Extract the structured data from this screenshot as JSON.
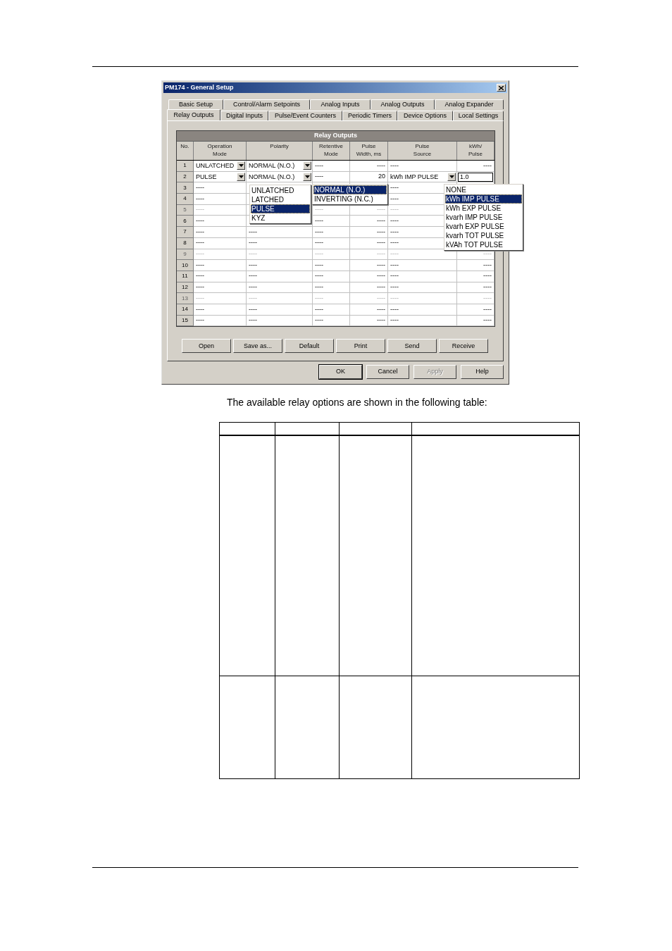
{
  "dialog": {
    "title": "PM174 - General Setup",
    "tab_rows": [
      [
        {
          "label": "Basic Setup",
          "selected": false
        },
        {
          "label": "Control/Alarm Setpoints",
          "selected": false
        },
        {
          "label": "Analog Inputs",
          "selected": false
        },
        {
          "label": "Analog Outputs",
          "selected": false
        },
        {
          "label": "Analog Expander",
          "selected": false
        }
      ],
      [
        {
          "label": "Relay Outputs",
          "selected": true
        },
        {
          "label": "Digital Inputs",
          "selected": false
        },
        {
          "label": "Pulse/Event Counters",
          "selected": false
        },
        {
          "label": "Periodic Timers",
          "selected": false
        },
        {
          "label": "Device Options",
          "selected": false
        },
        {
          "label": "Local Settings",
          "selected": false
        }
      ]
    ],
    "grid": {
      "title": "Relay Outputs",
      "columns": [
        "No.",
        "Operation\nMode",
        "Polarity",
        "Retentive\nMode",
        "Pulse\nWidth, ms",
        "Pulse\nSource",
        "kWh/\nPulse"
      ],
      "rows": [
        {
          "no": "1",
          "dimmed": false,
          "cells": [
            {
              "kind": "combo",
              "text": "UNLATCHED"
            },
            {
              "kind": "combo",
              "text": "NORMAL (N.O.)"
            },
            {
              "kind": "text",
              "text": "----"
            },
            {
              "kind": "text",
              "text": "----"
            },
            {
              "kind": "text",
              "text": "----"
            },
            {
              "kind": "text",
              "text": "----"
            }
          ]
        },
        {
          "no": "2",
          "dimmed": false,
          "cells": [
            {
              "kind": "combo",
              "text": "PULSE"
            },
            {
              "kind": "combo",
              "text": "NORMAL (N.O.)"
            },
            {
              "kind": "text",
              "text": "----"
            },
            {
              "kind": "text",
              "text": "20"
            },
            {
              "kind": "combo",
              "text": "kWh IMP PULSE"
            },
            {
              "kind": "edit",
              "text": "1.0"
            }
          ]
        },
        {
          "no": "3",
          "dimmed": false,
          "cells": [
            {
              "kind": "text",
              "text": "----"
            },
            null,
            null,
            null,
            {
              "kind": "text",
              "text": "----"
            },
            null
          ]
        },
        {
          "no": "4",
          "dimmed": false,
          "cells": [
            {
              "kind": "text",
              "text": "----"
            },
            null,
            null,
            null,
            {
              "kind": "text",
              "text": "----"
            },
            null
          ]
        },
        {
          "no": "5",
          "dimmed": true,
          "cells": [
            {
              "kind": "text",
              "text": "----"
            },
            null,
            {
              "kind": "text",
              "text": "----"
            },
            {
              "kind": "text",
              "text": "----"
            },
            {
              "kind": "text",
              "text": "----"
            },
            null
          ]
        },
        {
          "no": "6",
          "dimmed": false,
          "cells": [
            {
              "kind": "text",
              "text": "----"
            },
            null,
            {
              "kind": "text",
              "text": "----"
            },
            {
              "kind": "text",
              "text": "----"
            },
            {
              "kind": "text",
              "text": "----"
            },
            null
          ]
        },
        {
          "no": "7",
          "dimmed": false,
          "cells": [
            {
              "kind": "text",
              "text": "----"
            },
            {
              "kind": "text",
              "text": "----"
            },
            {
              "kind": "text",
              "text": "----"
            },
            {
              "kind": "text",
              "text": "----"
            },
            {
              "kind": "text",
              "text": "----"
            },
            null
          ]
        },
        {
          "no": "8",
          "dimmed": false,
          "cells": [
            {
              "kind": "text",
              "text": "----"
            },
            {
              "kind": "text",
              "text": "----"
            },
            {
              "kind": "text",
              "text": "----"
            },
            {
              "kind": "text",
              "text": "----"
            },
            {
              "kind": "text",
              "text": "----"
            },
            null
          ]
        },
        {
          "no": "9",
          "dimmed": true,
          "cells": [
            {
              "kind": "text",
              "text": "----"
            },
            {
              "kind": "text",
              "text": "----"
            },
            {
              "kind": "text",
              "text": "----"
            },
            {
              "kind": "text",
              "text": "----"
            },
            {
              "kind": "text",
              "text": "----"
            },
            {
              "kind": "text",
              "text": "----"
            }
          ]
        },
        {
          "no": "10",
          "dimmed": false,
          "cells": [
            {
              "kind": "text",
              "text": "----"
            },
            {
              "kind": "text",
              "text": "----"
            },
            {
              "kind": "text",
              "text": "----"
            },
            {
              "kind": "text",
              "text": "----"
            },
            {
              "kind": "text",
              "text": "----"
            },
            {
              "kind": "text",
              "text": "----"
            }
          ]
        },
        {
          "no": "11",
          "dimmed": false,
          "cells": [
            {
              "kind": "text",
              "text": "----"
            },
            {
              "kind": "text",
              "text": "----"
            },
            {
              "kind": "text",
              "text": "----"
            },
            {
              "kind": "text",
              "text": "----"
            },
            {
              "kind": "text",
              "text": "----"
            },
            {
              "kind": "text",
              "text": "----"
            }
          ]
        },
        {
          "no": "12",
          "dimmed": false,
          "cells": [
            {
              "kind": "text",
              "text": "----"
            },
            {
              "kind": "text",
              "text": "----"
            },
            {
              "kind": "text",
              "text": "----"
            },
            {
              "kind": "text",
              "text": "----"
            },
            {
              "kind": "text",
              "text": "----"
            },
            {
              "kind": "text",
              "text": "----"
            }
          ]
        },
        {
          "no": "13",
          "dimmed": true,
          "cells": [
            {
              "kind": "text",
              "text": "----"
            },
            {
              "kind": "text",
              "text": "----"
            },
            {
              "kind": "text",
              "text": "----"
            },
            {
              "kind": "text",
              "text": "----"
            },
            {
              "kind": "text",
              "text": "----"
            },
            {
              "kind": "text",
              "text": "----"
            }
          ]
        },
        {
          "no": "14",
          "dimmed": false,
          "cells": [
            {
              "kind": "text",
              "text": "----"
            },
            {
              "kind": "text",
              "text": "----"
            },
            {
              "kind": "text",
              "text": "----"
            },
            {
              "kind": "text",
              "text": "----"
            },
            {
              "kind": "text",
              "text": "----"
            },
            {
              "kind": "text",
              "text": "----"
            }
          ]
        },
        {
          "no": "15",
          "dimmed": false,
          "cells": [
            {
              "kind": "text",
              "text": "----"
            },
            {
              "kind": "text",
              "text": "----"
            },
            {
              "kind": "text",
              "text": "----"
            },
            {
              "kind": "text",
              "text": "----"
            },
            {
              "kind": "text",
              "text": "----"
            },
            {
              "kind": "text",
              "text": "----"
            }
          ]
        }
      ],
      "popups": [
        {
          "kind": "mode",
          "options": [
            {
              "label": "UNLATCHED",
              "selected": false
            },
            {
              "label": "LATCHED",
              "selected": false
            },
            {
              "label": "PULSE",
              "selected": true
            },
            {
              "label": "KYZ",
              "selected": false
            }
          ]
        },
        {
          "kind": "polarity",
          "options": [
            {
              "label": "NORMAL (N.O.)",
              "selected": true
            },
            {
              "label": "INVERTING (N.C.)",
              "selected": false
            }
          ]
        },
        {
          "kind": "source",
          "options": [
            {
              "label": "NONE",
              "selected": false
            },
            {
              "label": "kWh IMP PULSE",
              "selected": true
            },
            {
              "label": "kWh EXP PULSE",
              "selected": false
            },
            {
              "label": "kvarh IMP PULSE",
              "selected": false
            },
            {
              "label": "kvarh EXP PULSE",
              "selected": false
            },
            {
              "label": "kvarh TOT PULSE",
              "selected": false
            },
            {
              "label": "kVAh TOT PULSE",
              "selected": false
            }
          ]
        }
      ]
    },
    "panel_buttons": [
      {
        "label": "Open",
        "disabled": false
      },
      {
        "label": "Save as...",
        "disabled": false
      },
      {
        "label": "Default",
        "disabled": false
      },
      {
        "label": "Print",
        "disabled": false
      },
      {
        "label": "Send",
        "disabled": false
      },
      {
        "label": "Receive",
        "disabled": false
      }
    ],
    "dialog_buttons": [
      {
        "label": "OK",
        "disabled": false,
        "default": true
      },
      {
        "label": "Cancel",
        "disabled": false,
        "default": false
      },
      {
        "label": "Apply",
        "disabled": true,
        "default": false
      },
      {
        "label": "Help",
        "disabled": false,
        "default": false
      }
    ]
  },
  "caption": "The available relay options are shown in the following table:"
}
